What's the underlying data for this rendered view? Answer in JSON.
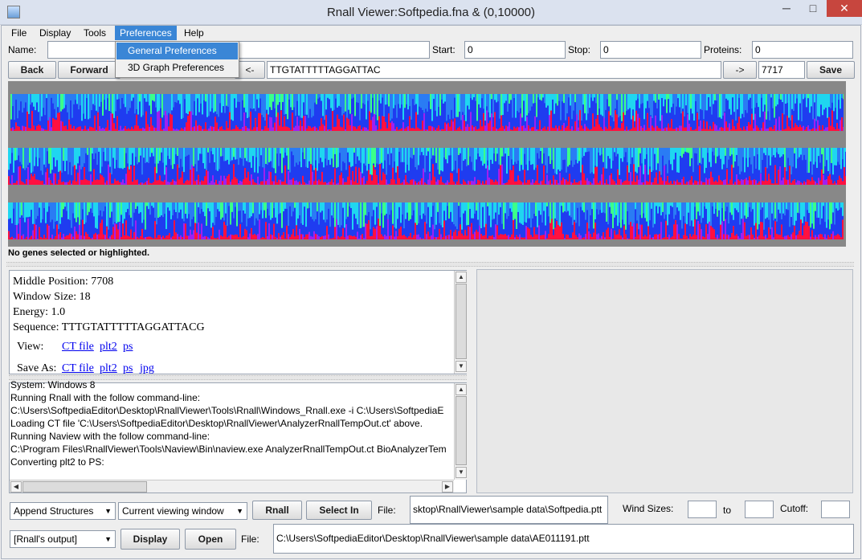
{
  "window": {
    "title": "Rnall Viewer:Softpedia.fna &  (0,10000)",
    "minimize": "─",
    "maximize": "□",
    "close": "✕"
  },
  "menubar": {
    "file": "File",
    "display": "Display",
    "tools": "Tools",
    "preferences": "Preferences",
    "help": "Help"
  },
  "preferences_menu": {
    "general": "General Preferences",
    "graph3d": "3D Graph Preferences"
  },
  "toolbar": {
    "name_label": "Name:",
    "name_value": "",
    "start_label": "Start:",
    "start_value": "0",
    "stop_label": "Stop:",
    "stop_value": "0",
    "proteins_label": "Proteins:",
    "proteins_value": "0",
    "back": "Back",
    "forward": "Forward",
    "prev": "<-",
    "next": "->",
    "sequence": "TTGTATTTTTAGGATTAC",
    "position": "7717",
    "save": "Save"
  },
  "status": "No genes selected or highlighted.",
  "info": {
    "middle": "Middle Position: 7708",
    "window_size": "Window Size: 18",
    "energy": "Energy: 1.0",
    "sequence": "Sequence: TTTGTATTTTTAGGATTACG",
    "view_label": "View:",
    "save_label": "Save As:",
    "ct": "CT file",
    "plt2": "plt2",
    "ps": "ps",
    "jpg": "jpg"
  },
  "log_lines": [
    "System: Windows 8",
    "Running Rnall with the follow command-line:",
    "C:\\Users\\SoftpediaEditor\\Desktop\\RnallViewer\\Tools\\Rnall\\Windows_Rnall.exe -i C:\\Users\\SoftpediaE",
    "Loading CT  file 'C:\\Users\\SoftpediaEditor\\Desktop\\RnallViewer\\AnalyzerRnallTempOut.ct' above.",
    "Running Naview with the follow command-line:",
    "C:\\Program Files\\RnallViewer\\Tools\\Naview\\Bin\\naview.exe AnalyzerRnallTempOut.ct BioAnalyzerTem",
    "Converting plt2 to PS:"
  ],
  "bottom": {
    "append": "Append Structures",
    "viewing": "Current viewing window",
    "rnall": "Rnall",
    "select_in": "Select In",
    "file_label": "File:",
    "file1": "sktop\\RnallViewer\\sample data\\Softpedia.ptt",
    "wind_sizes": "Wind Sizes:",
    "to": "to",
    "cutoff": "Cutoff:",
    "output": "[Rnall's output]",
    "display": "Display",
    "open": "Open",
    "file2": "C:\\Users\\SoftpediaEditor\\Desktop\\RnallViewer\\sample data\\AE011191.ptt"
  }
}
